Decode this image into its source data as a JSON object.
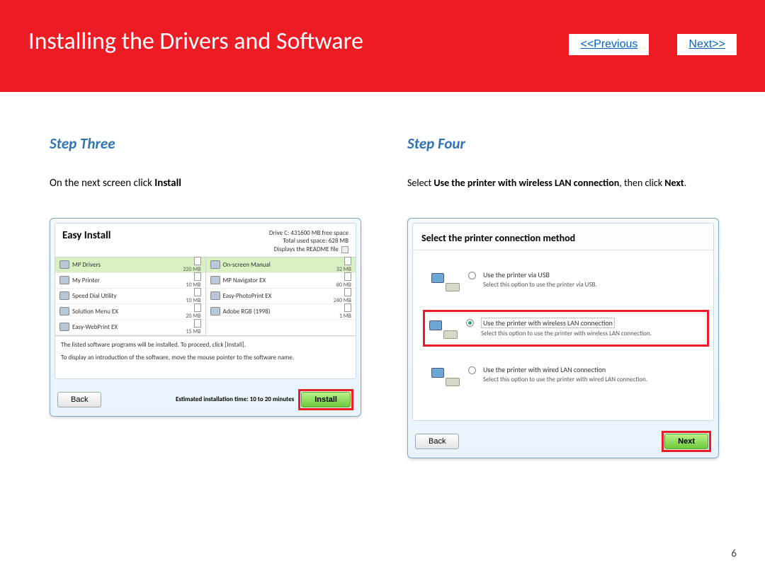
{
  "header": {
    "title": "Installing  the Drivers and Software",
    "prev": "<<Previous",
    "next": "Next>>"
  },
  "left": {
    "step_title": "Step Three",
    "desc_pre": "On the next screen click ",
    "desc_bold": "Install",
    "dlg_title": "Easy Install",
    "drive_line": "Drive C: 431600 MB free space",
    "space_line": "Total used space: 628 MB",
    "readme_line": "Displays the README file",
    "col1": [
      {
        "name": "MP Drivers",
        "size": "220 MB",
        "hl": true
      },
      {
        "name": "My Printer",
        "size": "10 MB",
        "hl": false
      },
      {
        "name": "Speed Dial Utility",
        "size": "10 MB",
        "hl": false
      },
      {
        "name": "Solution Menu EX",
        "size": "20 MB",
        "hl": false
      },
      {
        "name": "Easy-WebPrint EX",
        "size": "15 MB",
        "hl": false
      }
    ],
    "col2": [
      {
        "name": "On-screen Manual",
        "size": "32 MB",
        "hl": true
      },
      {
        "name": "MP Navigator EX",
        "size": "80 MB",
        "hl": false
      },
      {
        "name": "Easy-PhotoPrint EX",
        "size": "240 MB",
        "hl": false
      },
      {
        "name": "Adobe RGB (1998)",
        "size": "1 MB",
        "hl": false
      }
    ],
    "info1": "The listed software programs will be installed. To proceed, click [Install].",
    "info2": "To display an introduction of the software, move the mouse pointer to the software name.",
    "est": "Estimated installation time: 10 to 20 minutes",
    "back": "Back",
    "install": "Install"
  },
  "right": {
    "step_title": "Step Four",
    "desc_pre": "Select ",
    "desc_bold": "Use the printer with wireless LAN connection",
    "desc_mid": ", then click ",
    "desc_bold2": "Next",
    "desc_end": ".",
    "dlg_title": "Select the printer connection method",
    "opts": [
      {
        "main": "Use the printer via USB",
        "sub": "Select this option to use the printer via USB.",
        "sel": false,
        "hl": false
      },
      {
        "main": "Use the printer with wireless LAN connection",
        "sub": "Select this option to use the printer with wireless LAN connection.",
        "sel": true,
        "hl": true
      },
      {
        "main": "Use the printer with wired LAN connection",
        "sub": "Select this option to use the printer with wired LAN connection.",
        "sel": false,
        "hl": false
      }
    ],
    "back": "Back",
    "next": "Next"
  },
  "page_num": "6"
}
